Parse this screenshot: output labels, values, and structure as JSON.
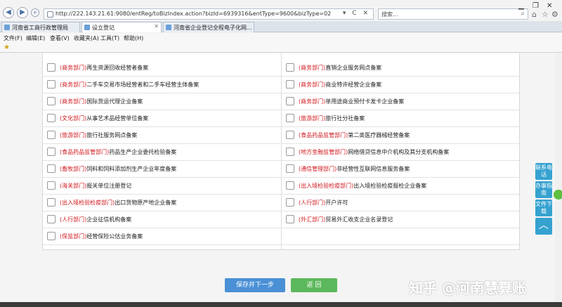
{
  "browser": {
    "url": "http://222.143.21.61:9080/entReg/toBizIndex.action?bizId=6939316&entType=9600&bizType=02",
    "addr_controls": "▾ C ✕",
    "search_placeholder": "搜索...",
    "tabs": [
      {
        "label": "河南省工商行政管理局"
      },
      {
        "label": "设立登记"
      },
      {
        "label": "河南省企业登记全程电子化网..."
      }
    ],
    "menu": [
      "文件(F)",
      "编辑(E)",
      "查看(V)",
      "收藏夹(A)",
      "工具(T)",
      "帮助(H)"
    ]
  },
  "form": {
    "rows": [
      [
        {
          "dept": "(商务部门)",
          "text": "再生资源回收经营者备案"
        },
        {
          "dept": "(商务部门)",
          "text": "直销企业服务网点备案"
        }
      ],
      [
        {
          "dept": "(商务部门)",
          "text": "二手车交易市场经营者和二手车经营主体备案"
        },
        {
          "dept": "(商务部门)",
          "text": "商业特许经营企业备案"
        }
      ],
      [
        {
          "dept": "(商务部门)",
          "text": "国际货运代理企业备案"
        },
        {
          "dept": "(商务部门)",
          "text": "单用途商业预付卡发卡企业备案"
        }
      ],
      [
        {
          "dept": "(文化部门)",
          "text": "从事艺术品经营单位备案"
        },
        {
          "dept": "(旅游部门)",
          "text": "旅行社分社备案"
        }
      ],
      [
        {
          "dept": "(旅游部门)",
          "text": "旅行社服务网点备案"
        },
        {
          "dept": "(食品药品监管部门)",
          "text": "第二类医疗器械经营备案"
        }
      ],
      [
        {
          "dept": "(食品药品监管部门)",
          "text": "药品生产企业委托检验备案"
        },
        {
          "dept": "(地方金融监管部门)",
          "text": "网络借贷信息中介机构及其分支机构备案"
        }
      ],
      [
        {
          "dept": "(畜牧部门)",
          "text": "饲料和饲料添加剂生产企业年度备案"
        },
        {
          "dept": "(通信管理部门)",
          "text": "非经营性互联网信息服务备案"
        }
      ],
      [
        {
          "dept": "(海关部门)",
          "text": "报关单位注册登记"
        },
        {
          "dept": "(出入境检验检疫部门)",
          "text": "出入境检验检疫报检企业备案"
        }
      ],
      [
        {
          "dept": "(出入境检验检疫部门)",
          "text": "出口货物原产地企业备案"
        },
        {
          "dept": "(人行部门)",
          "text": "开户许可"
        }
      ],
      [
        {
          "dept": "(人行部门)",
          "text": "企业征信机构备案"
        },
        {
          "dept": "(外汇部门)",
          "text": "贸易外汇收支企业名录登记"
        }
      ],
      [
        {
          "dept": "(保监部门)",
          "text": "经营保险公估业务备案"
        },
        null
      ]
    ],
    "save_label": "保存并下一步",
    "back_label": "返 回"
  },
  "side_tools": [
    {
      "label": "联系电话"
    },
    {
      "label": "办事指南"
    },
    {
      "label": "文件下载"
    }
  ],
  "watermark": "知乎 @河南慧算账",
  "colors": {
    "dept": "#d0171d",
    "save": "#4a90d6",
    "back": "#5cb85c",
    "side": "#36a2d0"
  }
}
